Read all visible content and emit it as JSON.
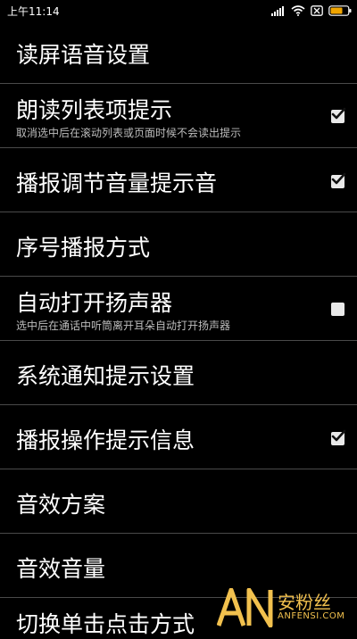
{
  "status_bar": {
    "time": "上午11:14",
    "icons": [
      "signal-icon",
      "wifi-icon",
      "sim-off-icon",
      "battery-icon"
    ]
  },
  "settings": {
    "items": [
      {
        "title": "读屏语音设置",
        "summary": "",
        "checkbox": null
      },
      {
        "title": "朗读列表项提示",
        "summary": "取消选中后在滚动列表或页面时候不会读出提示",
        "checkbox": true
      },
      {
        "title": "播报调节音量提示音",
        "summary": "",
        "checkbox": true
      },
      {
        "title": "序号播报方式",
        "summary": "",
        "checkbox": null
      },
      {
        "title": "自动打开扬声器",
        "summary": "选中后在通话中听筒离开耳朵自动打开扬声器",
        "checkbox": false
      },
      {
        "title": "系统通知提示设置",
        "summary": "",
        "checkbox": null
      },
      {
        "title": "播报操作提示信息",
        "summary": "",
        "checkbox": true
      },
      {
        "title": "音效方案",
        "summary": "",
        "checkbox": null
      },
      {
        "title": "音效音量",
        "summary": "",
        "checkbox": null
      },
      {
        "title": "切换单击点击方式",
        "summary": "",
        "checkbox": null
      }
    ]
  },
  "watermark": {
    "logo": "AN",
    "cn": "安粉丝",
    "en": "ANFENSI.COM"
  },
  "colors": {
    "background": "#000000",
    "divider": "#4a4a4a",
    "summary_text": "#bdbdbd",
    "watermark": "#f2c14e"
  }
}
